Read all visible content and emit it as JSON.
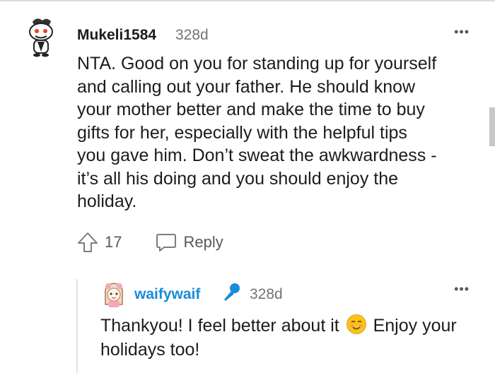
{
  "comment": {
    "username": "Mukeli1584",
    "age": "328d",
    "body": "NTA. Good on you for standing up for yourself\nand calling out your father. He should know\nyour mother better and make the time to buy\ngifts for her, especially with the helpful tips\nyou gave him. Don’t sweat the awkwardness -\nit’s all his doing and you should enjoy the\nholiday.",
    "votes": "17",
    "reply_label": "Reply",
    "more_label": "•••"
  },
  "reply": {
    "username": "waifywaif",
    "age": "328d",
    "body_before_emoji": "Thankyou! I feel better about it ",
    "body_after_emoji": " Enjoy your holidays too!",
    "more_label": "•••"
  },
  "colors": {
    "accent_username": "#1a8cd8",
    "meta_gray": "#6f7577",
    "text": "#1c1c1c"
  },
  "icons": {
    "avatar1": "snoo-avatar-icon",
    "avatar2": "girl-avatar-icon",
    "upvote": "upvote-arrow-icon",
    "reply": "speech-bubble-icon",
    "flair": "microphone-icon",
    "emoji": "smiling-face-emoji-icon"
  }
}
